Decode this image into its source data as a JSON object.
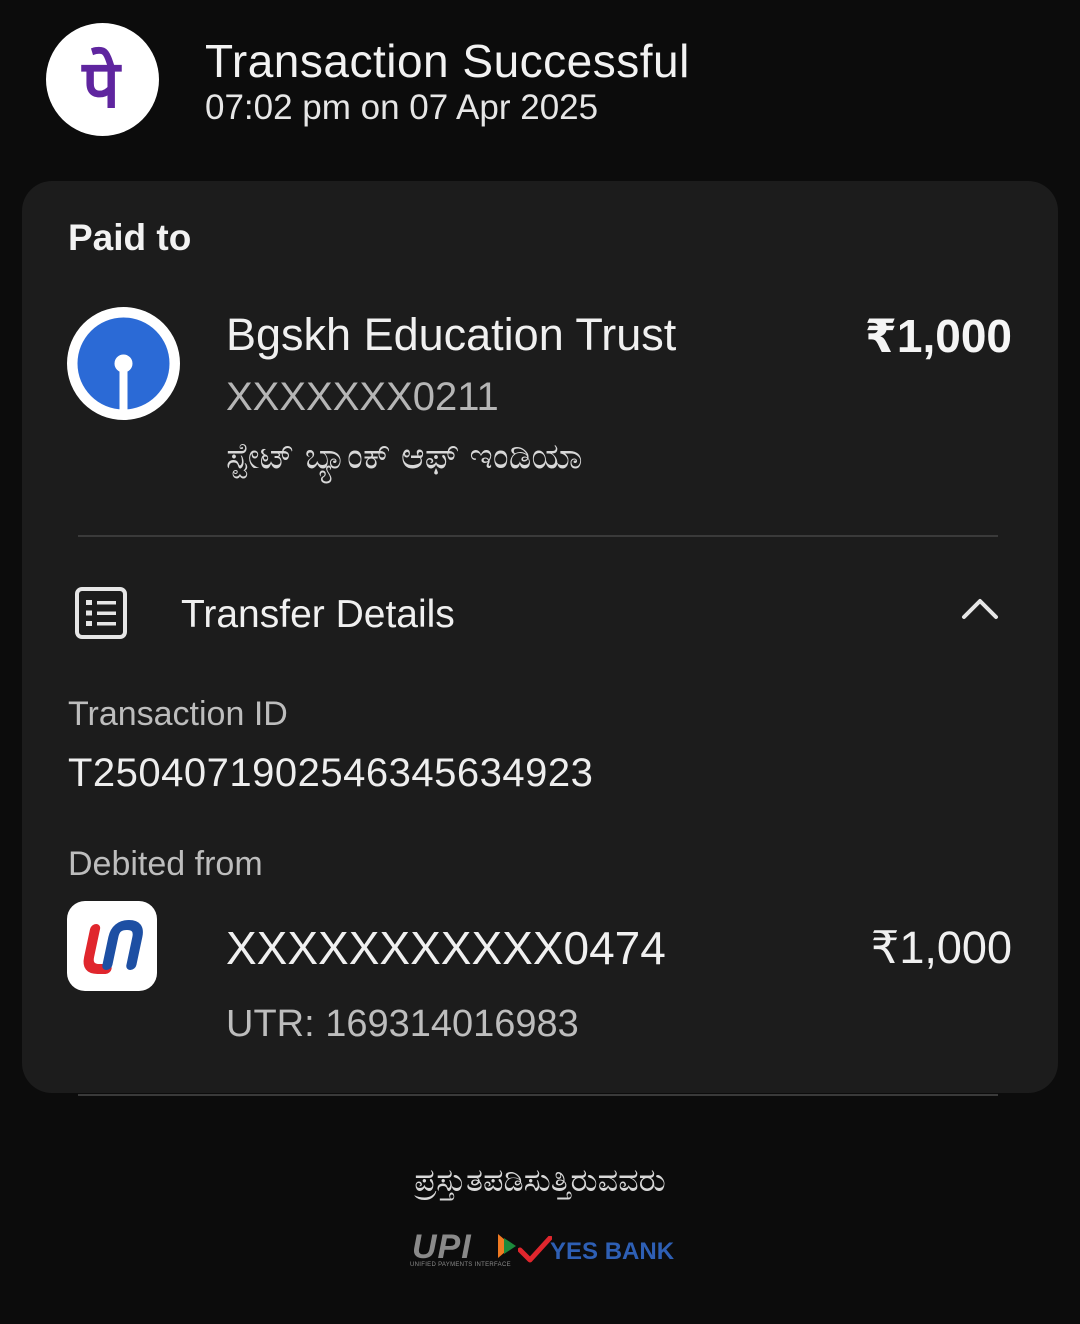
{
  "header": {
    "title": "Transaction Successful",
    "timestamp": "07:02 pm on 07 Apr 2025",
    "logo_glyph": "पे",
    "logo_color": "#5f259f"
  },
  "paid_to": {
    "label": "Paid to",
    "name": "Bgskh Education Trust",
    "amount": "₹1,000",
    "account": "XXXXXXX0211",
    "bank": "ಸ್ಟೇಟ್ ಬ್ಯಾಂಕ್ ಆಫ್ ಇಂಡಿಯಾ",
    "logo_color": "#2b6ad6"
  },
  "transfer_details": {
    "label": "Transfer Details",
    "expanded": true,
    "transaction_id_label": "Transaction ID",
    "transaction_id": "T2504071902546345634923",
    "debited_from_label": "Debited from",
    "debit_account": "XXXXXXXXXXX0474",
    "debit_amount": "₹1,000",
    "utr": "UTR: 169314016983"
  },
  "footer": {
    "powered_by": "ಪ್ರಸ್ತುತಪಡಿಸುತ್ತಿರುವವರು",
    "upi_wordmark": "UPI",
    "upi_tagline": "UNIFIED PAYMENTS INTERFACE",
    "yes_bank_wordmark": "YES BANK",
    "yes_bank_color": "#2e5fb4",
    "yes_tick_color": "#e0262d"
  },
  "icons": {
    "app_logo": "phonepe-logo-icon",
    "payee_bank_logo": "sbi-logo-icon",
    "transfer_details": "receipt-list-icon",
    "toggle": "chevron-up-icon",
    "debit_bank_logo": "union-bank-logo-icon"
  }
}
